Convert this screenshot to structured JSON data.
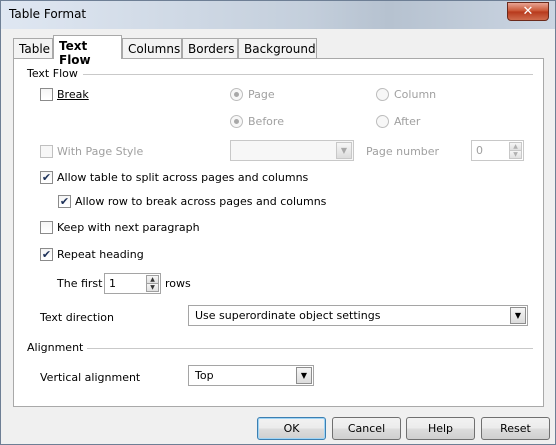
{
  "window": {
    "title": "Table Format",
    "close_glyph": "✕"
  },
  "tabs": [
    {
      "label": "Table",
      "active": false
    },
    {
      "label": "Text Flow",
      "active": true
    },
    {
      "label": "Columns",
      "active": false
    },
    {
      "label": "Borders",
      "active": false
    },
    {
      "label": "Background",
      "active": false
    }
  ],
  "text_flow": {
    "section_label": "Text Flow",
    "break": {
      "label": "Break",
      "checked": false
    },
    "break_type": {
      "page": "Page",
      "column": "Column",
      "selected": "Page"
    },
    "break_position": {
      "before": "Before",
      "after": "After",
      "selected": "Before"
    },
    "with_page_style": {
      "label": "With Page Style",
      "checked": false,
      "value": ""
    },
    "page_number": {
      "label": "Page number",
      "value": "0"
    },
    "allow_split": {
      "label": "Allow table to split across pages and columns",
      "checked": true
    },
    "allow_row_break": {
      "label": "Allow row to break across pages and columns",
      "checked": true
    },
    "keep_with_next": {
      "label": "Keep with next paragraph",
      "checked": false
    },
    "repeat_heading": {
      "label": "Repeat heading",
      "checked": true
    },
    "first_rows": {
      "prefix": "The first",
      "value": "1",
      "suffix": "rows"
    },
    "text_direction": {
      "label": "Text direction",
      "value": "Use superordinate object settings"
    }
  },
  "alignment": {
    "section_label": "Alignment",
    "vertical_alignment": {
      "label": "Vertical alignment",
      "value": "Top"
    }
  },
  "buttons": {
    "ok": "OK",
    "cancel": "Cancel",
    "help": "Help",
    "reset": "Reset"
  },
  "glyphs": {
    "check": "✔",
    "dropdown": "▼",
    "spin_up": "▲",
    "spin_down": "▼"
  },
  "colors": {
    "accent": "#3c7fb1",
    "disabled_text": "#a0a0a0"
  }
}
